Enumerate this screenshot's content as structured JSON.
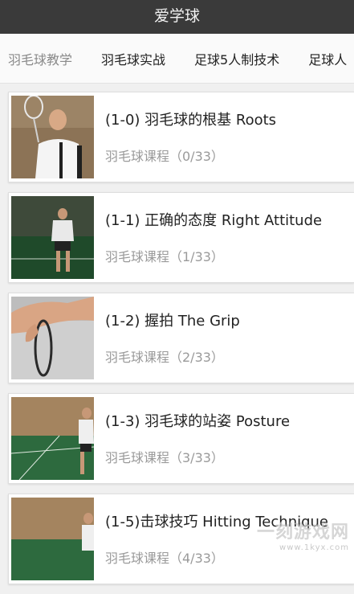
{
  "app": {
    "title": "爱学球"
  },
  "tabs": [
    "羽毛球教学",
    "羽毛球实战",
    "足球5人制技术",
    "足球人"
  ],
  "lessons": [
    {
      "title": "(1-0) 羽毛球的根基 Roots",
      "subtitle": "羽毛球课程（0/33）"
    },
    {
      "title": "(1-1) 正确的态度 Right Attitude",
      "subtitle": "羽毛球课程（1/33）"
    },
    {
      "title": "(1-2) 握拍 The Grip",
      "subtitle": "羽毛球课程（2/33）"
    },
    {
      "title": "(1-3) 羽毛球的站姿 Posture",
      "subtitle": "羽毛球课程（3/33）"
    },
    {
      "title": "(1-5)击球技巧 Hitting Technique",
      "subtitle": "羽毛球课程（4/33）"
    }
  ],
  "watermark": {
    "text": "一刻游戏网",
    "url": "www.1kyx.com"
  }
}
